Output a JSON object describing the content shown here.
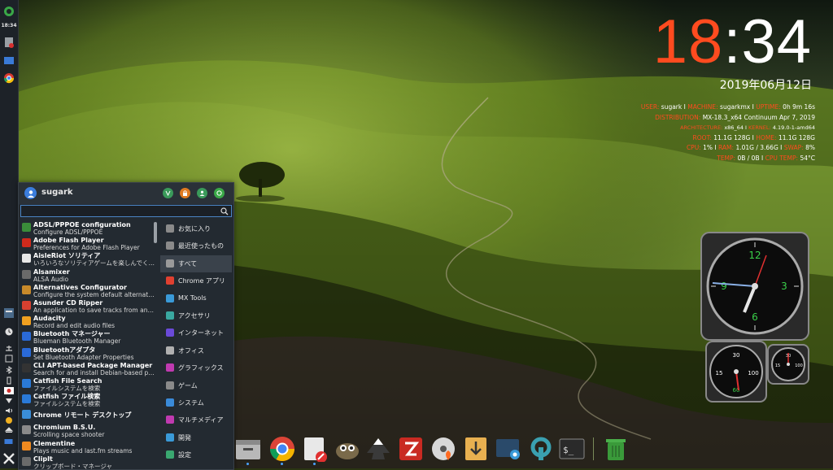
{
  "panel": {
    "clock": "18:34",
    "launchers": [
      "menu-icon",
      "file-manager-icon",
      "folder-icon",
      "chrome-icon"
    ],
    "tray": [
      "clock-icon",
      "network-icon",
      "bluetooth-icon",
      "clipboard-icon",
      "flag-icon",
      "volume-icon",
      "updates-icon",
      "eject-icon",
      "battery-icon"
    ]
  },
  "clock_widget": {
    "hour": "18",
    "colon": ":",
    "minutes": "34",
    "date": "2019年06月12日"
  },
  "sysinfo": [
    {
      "key": "USER:",
      "val": "sugark",
      "key2": "MACHINE:",
      "val2": "sugarkmx",
      "key3": "UPTIME:",
      "val3": "0h 9m 16s"
    },
    {
      "key": "DISTRIBUTION:",
      "val": "MX-18.3_x64 Continuum Apr 7, 2019"
    },
    {
      "key": "ARCHITECTURE:",
      "val": "x86_64",
      "key2": "KERNEL:",
      "val2": "4.19.0-1-amd64"
    },
    {
      "key": "ROOT:",
      "val": "11.1G",
      "val_b": "128G",
      "key2": "HOME:",
      "val2": "11.1G",
      "val2_b": "128G"
    },
    {
      "key": "CPU:",
      "val": "1%",
      "key2": "RAM:",
      "val2": "1.01G / 3.66G",
      "key3": "SWAP:",
      "val3": "8%"
    },
    {
      "key": "TEMP:",
      "val": "0B / 0B",
      "key2": "CPU TEMP:",
      "val2": "54°C"
    }
  ],
  "menu": {
    "user": "sugark",
    "search_placeholder": "",
    "apps": [
      {
        "name": "ADSL/PPPOE configuration",
        "desc": "Configure ADSL/PPPOE",
        "color": "#3a8d3a"
      },
      {
        "name": "Adobe Flash Player",
        "desc": "Preferences for Adobe Flash Player",
        "color": "#d02a1c"
      },
      {
        "name": "AisleRiot ソリティア",
        "desc": "いろいろなソリティアゲームを楽しんでください",
        "color": "#e8e8e8"
      },
      {
        "name": "Alsamixer",
        "desc": "ALSA Audio",
        "color": "#6a6a6a"
      },
      {
        "name": "Alternatives Configurator",
        "desc": "Configure the system default alternatives",
        "color": "#c88a2a"
      },
      {
        "name": "Asunder CD Ripper",
        "desc": "An application to save tracks from an Audio CD",
        "color": "#d84030"
      },
      {
        "name": "Audacity",
        "desc": "Record and edit audio files",
        "color": "#f0a020"
      },
      {
        "name": "Bluetooth マネージャー",
        "desc": "Blueman Bluetooth Manager",
        "color": "#2a6ad8"
      },
      {
        "name": "Bluetoothアダプタ",
        "desc": "Set Bluetooth Adapter Properties",
        "color": "#2a6ad8"
      },
      {
        "name": "CLI APT-based Package Manager",
        "desc": "Search for and install Debian-based packages",
        "color": "#333333"
      },
      {
        "name": "Catfish File Search",
        "desc": "ファイルシステムを検索",
        "color": "#2a7ad8"
      },
      {
        "name": "Catfish ファイル検索",
        "desc": "ファイルシステムを検索",
        "color": "#2a7ad8"
      },
      {
        "name": "Chrome リモート デスクトップ",
        "desc": "",
        "color": "#3a8dd8"
      },
      {
        "name": "Chromium B.S.U.",
        "desc": "Scrolling space shooter",
        "color": "#8a8a8a"
      },
      {
        "name": "Clementine",
        "desc": "Plays music and last.fm streams",
        "color": "#f08a20"
      },
      {
        "name": "ClipIt",
        "desc": "クリップボード・マネージャ",
        "color": "#6a6a6a"
      }
    ],
    "categories": [
      {
        "label": "お気に入り",
        "color": "#8a8a8a"
      },
      {
        "label": "最近使ったもの",
        "color": "#8a8a8a"
      },
      {
        "label": "すべて",
        "color": "#9a9a9a"
      },
      {
        "label": "Chrome アプリ",
        "color": "#e04030"
      },
      {
        "label": "MX Tools",
        "color": "#3a9ad8"
      },
      {
        "label": "アクセサリ",
        "color": "#3aa8a0"
      },
      {
        "label": "インターネット",
        "color": "#6a4ad8"
      },
      {
        "label": "オフィス",
        "color": "#b0b0b0"
      },
      {
        "label": "グラフィックス",
        "color": "#c03ab0"
      },
      {
        "label": "ゲーム",
        "color": "#8a8a8a"
      },
      {
        "label": "システム",
        "color": "#3a8ad8"
      },
      {
        "label": "マルチメディア",
        "color": "#c03ab0"
      },
      {
        "label": "開発",
        "color": "#3a9ad8"
      },
      {
        "label": "設定",
        "color": "#3aa870"
      }
    ],
    "active_category": 2
  },
  "dock": [
    "file-manager-icon",
    "chrome-icon",
    "text-editor-icon",
    "gimp-icon",
    "inkscape-icon",
    "filezilla-icon",
    "disc-burner-icon",
    "downloader-icon",
    "screenshot-icon",
    "settings-wrench-icon",
    "terminal-icon",
    "trash-icon"
  ]
}
